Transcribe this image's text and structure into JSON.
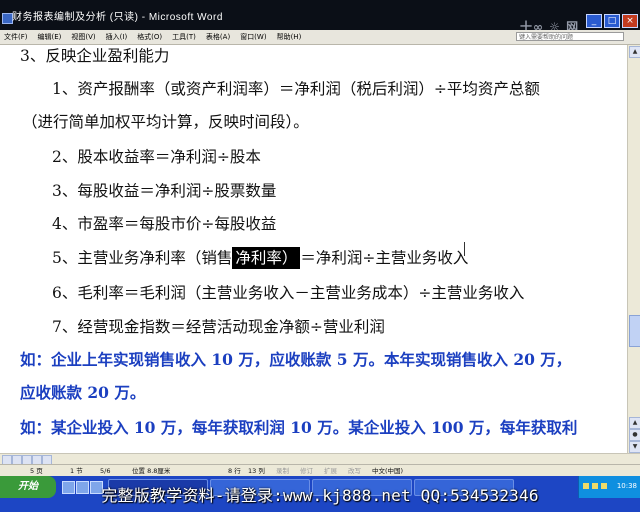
{
  "window": {
    "title": "财务报表编制及分析 (只读) - Microsoft Word",
    "controls": {
      "minimize": "_",
      "maximize": "□",
      "close": "×"
    }
  },
  "menu": {
    "items": [
      "文件(F)",
      "编辑(E)",
      "视图(V)",
      "插入(I)",
      "格式(O)",
      "工具(T)",
      "表格(A)",
      "窗口(W)",
      "帮助(H)"
    ],
    "help_placeholder": "键入需要帮助的问题"
  },
  "document": {
    "heading": "3、反映企业盈利能力",
    "l1a": "1、资产报酬率（或资产利润率）＝净利润（税后利润）÷平均资产总额",
    "l1b": "（进行简单加权平均计算，反映时间段）。",
    "l2": "2、股本收益率＝净利润÷股本",
    "l3": "3、每股收益＝净利润÷股票数量",
    "l4": "4、市盈率＝每股市价÷每股收益",
    "l5_pre": "5、主营业务净利率（销售",
    "l5_hl": "净利率）",
    "l5_post": "＝净利润÷主营业务收入",
    "l6": "6、毛利率＝毛利润（主营业务收入－主营业务成本）÷主营业务收入",
    "l7": "7、经营现金指数＝经营活动现金净额÷营业利润",
    "ex1a": "如：企业上年实现销售收入 10 万，应收账款 5 万。本年实现销售收入 20 万，",
    "ex1b": "应收账款 20 万。",
    "ex2": "如：某企业投入 10 万，每年获取利润 10 万。某企业投入 100 万，每年获取利"
  },
  "status": {
    "page": "5 页",
    "section": "1 节",
    "page_of": "5/6",
    "position": "位置 8.8厘米",
    "line": "8 行",
    "column": "13 列",
    "rec": "录制",
    "trk": "修订",
    "ext": "扩展",
    "ovr": "改写",
    "language": "中文(中国)"
  },
  "taskbar": {
    "start_label": "开始",
    "clock": "10:38"
  },
  "banner": "完整版教学资料-请登录:www.kj888.net QQ:534532346",
  "colors": {
    "blue_text": "#1b3fc0",
    "taskbar": "#1d46c4"
  }
}
